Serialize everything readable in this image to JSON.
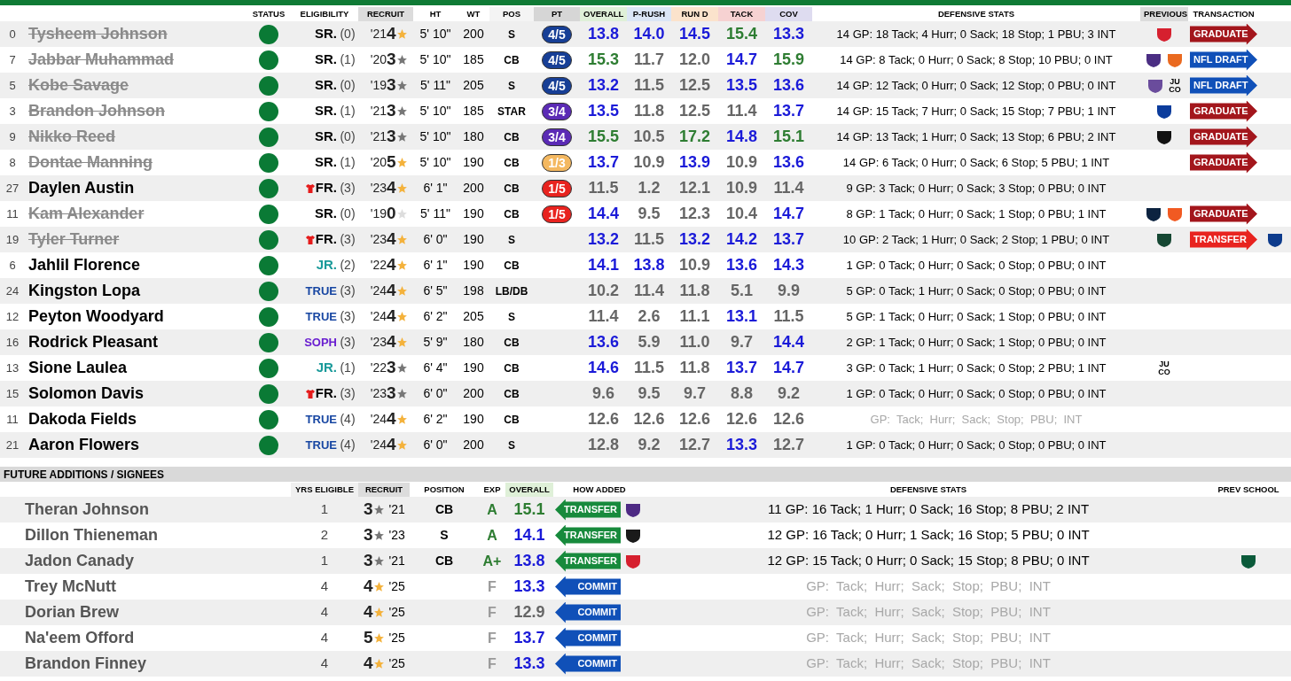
{
  "roster": {
    "columns": [
      {
        "label": "STATUS"
      },
      {
        "label": "ELIGIBILITY"
      },
      {
        "label": "RECRUIT",
        "color": "#dcdcdc"
      },
      {
        "label": "HT"
      },
      {
        "label": "WT"
      },
      {
        "label": "POS",
        "color": "#f4f4f4"
      },
      {
        "label": "PT",
        "color": "#d6d6d6"
      },
      {
        "label": "OVERALL",
        "color": "#dff0d8"
      },
      {
        "label": "P-RUSH",
        "color": "#dbe6f6"
      },
      {
        "label": "RUN D",
        "color": "#fbe3cc"
      },
      {
        "label": "TACK",
        "color": "#f6d2d2"
      },
      {
        "label": "COV",
        "color": "#dedcf0"
      },
      {
        "label": "DEFENSIVE STATS"
      },
      {
        "label": "PREVIOUS",
        "color": "#dcdcdc"
      },
      {
        "label": "TRANSACTION"
      }
    ],
    "rows": [
      {
        "number": "0",
        "name": "Tysheem Johnson",
        "departed": true,
        "class": {
          "text": "SR.",
          "color": "#000000"
        },
        "redshirt": false,
        "years": "(0)",
        "year": "'21",
        "rating": "4",
        "star": {
          "color": "#f4b23c"
        },
        "ht": "5' 10\"",
        "wt": "200",
        "pos": "S",
        "pt": {
          "text": "4/5",
          "color": "#173f96"
        },
        "grades": [
          {
            "value": "13.8",
            "color": "#1a1ad8"
          },
          {
            "value": "14.0",
            "color": "#1a1ad8"
          },
          {
            "value": "14.5",
            "color": "#1a1ad8"
          },
          {
            "value": "15.4",
            "color": "#2e7d32"
          },
          {
            "value": "13.3",
            "color": "#1a1ad8"
          }
        ],
        "stats": "14 GP: 18 Tack; 4 Hurr; 0 Sack; 18 Stop; 1 PBU; 3 INT",
        "faint": false,
        "previous": [
          {
            "kind": "logo",
            "color": "#d6202f"
          }
        ],
        "transaction": {
          "label": "GRADUATE",
          "kind": "graduate"
        }
      },
      {
        "number": "7",
        "name": "Jabbar Muhammad",
        "departed": true,
        "class": {
          "text": "SR.",
          "color": "#000000"
        },
        "redshirt": false,
        "years": "(1)",
        "year": "'20",
        "rating": "3",
        "star": {
          "color": "#777777"
        },
        "ht": "5' 10\"",
        "wt": "185",
        "pos": "CB",
        "pt": {
          "text": "4/5",
          "color": "#173f96"
        },
        "grades": [
          {
            "value": "15.3",
            "color": "#2e7d32"
          },
          {
            "value": "11.7",
            "color": "#666666"
          },
          {
            "value": "12.0",
            "color": "#666666"
          },
          {
            "value": "14.7",
            "color": "#1a1ad8"
          },
          {
            "value": "15.9",
            "color": "#2e7d32"
          }
        ],
        "stats": "14 GP: 8 Tack; 0 Hurr; 0 Sack; 8 Stop; 10 PBU; 0 INT",
        "faint": false,
        "previous": [
          {
            "kind": "logo",
            "color": "#4b2e83"
          },
          {
            "kind": "logo",
            "color": "#ea6a20"
          }
        ],
        "transaction": {
          "label": "NFL DRAFT",
          "kind": "draft"
        }
      },
      {
        "number": "5",
        "name": "Kobe Savage",
        "departed": true,
        "class": {
          "text": "SR.",
          "color": "#000000"
        },
        "redshirt": false,
        "years": "(0)",
        "year": "'19",
        "rating": "3",
        "star": {
          "color": "#777777"
        },
        "ht": "5' 11\"",
        "wt": "205",
        "pos": "S",
        "pt": {
          "text": "4/5",
          "color": "#173f96"
        },
        "grades": [
          {
            "value": "13.2",
            "color": "#1a1ad8"
          },
          {
            "value": "11.5",
            "color": "#666666"
          },
          {
            "value": "12.5",
            "color": "#666666"
          },
          {
            "value": "13.5",
            "color": "#1a1ad8"
          },
          {
            "value": "13.6",
            "color": "#1a1ad8"
          }
        ],
        "stats": "14 GP: 12 Tack; 0 Hurr; 0 Sack; 12 Stop; 0 PBU; 0 INT",
        "faint": false,
        "previous": [
          {
            "kind": "logo",
            "color": "#6a4c9c"
          },
          {
            "kind": "text",
            "text": "JU CO"
          }
        ],
        "transaction": {
          "label": "NFL DRAFT",
          "kind": "draft"
        }
      },
      {
        "number": "3",
        "name": "Brandon Johnson",
        "departed": true,
        "class": {
          "text": "SR.",
          "color": "#000000"
        },
        "redshirt": false,
        "years": "(1)",
        "year": "'21",
        "rating": "3",
        "star": {
          "color": "#777777"
        },
        "ht": "5' 10\"",
        "wt": "185",
        "pos": "STAR",
        "pt": {
          "text": "3/4",
          "color": "#5b2bb5"
        },
        "grades": [
          {
            "value": "13.5",
            "color": "#1a1ad8"
          },
          {
            "value": "11.8",
            "color": "#666666"
          },
          {
            "value": "12.5",
            "color": "#666666"
          },
          {
            "value": "11.4",
            "color": "#666666"
          },
          {
            "value": "13.7",
            "color": "#1a1ad8"
          }
        ],
        "stats": "14 GP: 15 Tack; 7 Hurr; 0 Sack; 15 Stop; 7 PBU; 1 INT",
        "faint": false,
        "previous": [
          {
            "kind": "logo",
            "color": "#0b3c9c"
          }
        ],
        "transaction": {
          "label": "GRADUATE",
          "kind": "graduate"
        }
      },
      {
        "number": "9",
        "name": "Nikko Reed",
        "departed": true,
        "class": {
          "text": "SR.",
          "color": "#000000"
        },
        "redshirt": false,
        "years": "(0)",
        "year": "'21",
        "rating": "3",
        "star": {
          "color": "#777777"
        },
        "ht": "5' 10\"",
        "wt": "180",
        "pos": "CB",
        "pt": {
          "text": "3/4",
          "color": "#5b2bb5"
        },
        "grades": [
          {
            "value": "15.5",
            "color": "#2e7d32"
          },
          {
            "value": "10.5",
            "color": "#666666"
          },
          {
            "value": "17.2",
            "color": "#2e7d32"
          },
          {
            "value": "14.8",
            "color": "#1a1ad8"
          },
          {
            "value": "15.1",
            "color": "#2e7d32"
          }
        ],
        "stats": "14 GP: 13 Tack; 1 Hurr; 0 Sack; 13 Stop; 6 PBU; 2 INT",
        "faint": false,
        "previous": [
          {
            "kind": "logo",
            "color": "#111111"
          }
        ],
        "transaction": {
          "label": "GRADUATE",
          "kind": "graduate"
        }
      },
      {
        "number": "8",
        "name": "Dontae Manning",
        "departed": true,
        "class": {
          "text": "SR.",
          "color": "#000000"
        },
        "redshirt": false,
        "years": "(1)",
        "year": "'20",
        "rating": "5",
        "star": {
          "color": "#f4b23c"
        },
        "ht": "5' 10\"",
        "wt": "190",
        "pos": "CB",
        "pt": {
          "text": "1/3",
          "color": "#f4b860"
        },
        "grades": [
          {
            "value": "13.7",
            "color": "#1a1ad8"
          },
          {
            "value": "10.9",
            "color": "#666666"
          },
          {
            "value": "13.9",
            "color": "#1a1ad8"
          },
          {
            "value": "10.9",
            "color": "#666666"
          },
          {
            "value": "13.6",
            "color": "#1a1ad8"
          }
        ],
        "stats": "14 GP: 6 Tack; 0 Hurr; 0 Sack; 6 Stop; 5 PBU; 1 INT",
        "faint": false,
        "transaction": {
          "label": "GRADUATE",
          "kind": "graduate"
        }
      },
      {
        "number": "27",
        "name": "Daylen Austin",
        "departed": false,
        "class": {
          "text": "FR.",
          "color": "#000000"
        },
        "redshirt": true,
        "years": "(3)",
        "year": "'23",
        "rating": "4",
        "star": {
          "color": "#f4b23c"
        },
        "ht": "6' 1\"",
        "wt": "200",
        "pos": "CB",
        "pt": {
          "text": "1/5",
          "color": "#e8231f"
        },
        "grades": [
          {
            "value": "11.5",
            "color": "#666666"
          },
          {
            "value": "1.2",
            "color": "#666666"
          },
          {
            "value": "12.1",
            "color": "#666666"
          },
          {
            "value": "10.9",
            "color": "#666666"
          },
          {
            "value": "11.4",
            "color": "#666666"
          }
        ],
        "stats": "9 GP: 3 Tack; 0 Hurr; 0 Sack; 3 Stop; 0 PBU; 0 INT",
        "faint": false
      },
      {
        "number": "11",
        "name": "Kam Alexander",
        "departed": true,
        "class": {
          "text": "SR.",
          "color": "#000000"
        },
        "redshirt": false,
        "years": "(0)",
        "year": "'19",
        "rating": "0",
        "star": {
          "color": "#dddddd"
        },
        "ht": "5' 11\"",
        "wt": "190",
        "pos": "CB",
        "pt": {
          "text": "1/5",
          "color": "#e8231f"
        },
        "grades": [
          {
            "value": "14.4",
            "color": "#1a1ad8"
          },
          {
            "value": "9.5",
            "color": "#666666"
          },
          {
            "value": "12.3",
            "color": "#666666"
          },
          {
            "value": "10.4",
            "color": "#666666"
          },
          {
            "value": "14.7",
            "color": "#1a1ad8"
          }
        ],
        "stats": "8 GP: 1 Tack; 0 Hurr; 0 Sack; 1 Stop; 0 PBU; 1 INT",
        "faint": false,
        "previous": [
          {
            "kind": "logo",
            "color": "#0c2340"
          },
          {
            "kind": "logo",
            "color": "#f15a22"
          }
        ],
        "transaction": {
          "label": "GRADUATE",
          "kind": "graduate"
        }
      },
      {
        "number": "19",
        "name": "Tyler Turner",
        "departed": true,
        "class": {
          "text": "FR.",
          "color": "#000000"
        },
        "redshirt": true,
        "years": "(3)",
        "year": "'23",
        "rating": "4",
        "star": {
          "color": "#f4b23c"
        },
        "ht": "6' 0\"",
        "wt": "190",
        "pos": "S",
        "grades": [
          {
            "value": "13.2",
            "color": "#1a1ad8"
          },
          {
            "value": "11.5",
            "color": "#666666"
          },
          {
            "value": "13.2",
            "color": "#1a1ad8"
          },
          {
            "value": "14.2",
            "color": "#1a1ad8"
          },
          {
            "value": "13.7",
            "color": "#1a1ad8"
          }
        ],
        "stats": "10 GP: 2 Tack; 1 Hurr; 0 Sack; 2 Stop; 1 PBU; 0 INT",
        "faint": false,
        "previous": [
          {
            "kind": "logo",
            "color": "#154733"
          }
        ],
        "transaction": {
          "label": "TRANSFER",
          "kind": "transfer"
        },
        "destination": {
          "kind": "logo",
          "color": "#0d3b8c"
        }
      },
      {
        "number": "6",
        "name": "Jahlil Florence",
        "departed": false,
        "class": {
          "text": "JR.",
          "color": "#1a9a9a"
        },
        "redshirt": false,
        "years": "(2)",
        "year": "'22",
        "rating": "4",
        "star": {
          "color": "#f4b23c"
        },
        "ht": "6' 1\"",
        "wt": "190",
        "pos": "CB",
        "grades": [
          {
            "value": "14.1",
            "color": "#1a1ad8"
          },
          {
            "value": "13.8",
            "color": "#1a1ad8"
          },
          {
            "value": "10.9",
            "color": "#666666"
          },
          {
            "value": "13.6",
            "color": "#1a1ad8"
          },
          {
            "value": "14.3",
            "color": "#1a1ad8"
          }
        ],
        "stats": "1 GP: 0 Tack; 0 Hurr; 0 Sack; 0 Stop; 0 PBU; 0 INT",
        "faint": false
      },
      {
        "number": "24",
        "name": "Kingston Lopa",
        "departed": false,
        "class": {
          "text": "TRUE",
          "color": "#1746a2"
        },
        "redshirt": false,
        "years": "(3)",
        "year": "'24",
        "rating": "4",
        "star": {
          "color": "#f4b23c"
        },
        "ht": "6' 5\"",
        "wt": "198",
        "pos": "LB/DB",
        "grades": [
          {
            "value": "10.2",
            "color": "#666666"
          },
          {
            "value": "11.4",
            "color": "#666666"
          },
          {
            "value": "11.8",
            "color": "#666666"
          },
          {
            "value": "5.1",
            "color": "#666666"
          },
          {
            "value": "9.9",
            "color": "#666666"
          }
        ],
        "stats": "5 GP: 0 Tack; 1 Hurr; 0 Sack; 0 Stop; 0 PBU; 0 INT",
        "faint": false
      },
      {
        "number": "12",
        "name": "Peyton Woodyard",
        "departed": false,
        "class": {
          "text": "TRUE",
          "color": "#1746a2"
        },
        "redshirt": false,
        "years": "(3)",
        "year": "'24",
        "rating": "4",
        "star": {
          "color": "#f4b23c"
        },
        "ht": "6' 2\"",
        "wt": "205",
        "pos": "S",
        "grades": [
          {
            "value": "11.4",
            "color": "#666666"
          },
          {
            "value": "2.6",
            "color": "#666666"
          },
          {
            "value": "11.1",
            "color": "#666666"
          },
          {
            "value": "13.1",
            "color": "#1a1ad8"
          },
          {
            "value": "11.5",
            "color": "#666666"
          }
        ],
        "stats": "5 GP: 1 Tack; 0 Hurr; 0 Sack; 1 Stop; 0 PBU; 0 INT",
        "faint": false
      },
      {
        "number": "16",
        "name": "Rodrick Pleasant",
        "departed": false,
        "class": {
          "text": "SOPH",
          "color": "#6a1fd0"
        },
        "redshirt": false,
        "years": "(3)",
        "year": "'23",
        "rating": "4",
        "star": {
          "color": "#f4b23c"
        },
        "ht": "5' 9\"",
        "wt": "180",
        "pos": "CB",
        "grades": [
          {
            "value": "13.6",
            "color": "#1a1ad8"
          },
          {
            "value": "5.9",
            "color": "#666666"
          },
          {
            "value": "11.0",
            "color": "#666666"
          },
          {
            "value": "9.7",
            "color": "#666666"
          },
          {
            "value": "14.4",
            "color": "#1a1ad8"
          }
        ],
        "stats": "2 GP: 1 Tack; 0 Hurr; 0 Sack; 1 Stop; 0 PBU; 0 INT",
        "faint": false
      },
      {
        "number": "13",
        "name": "Sione Laulea",
        "departed": false,
        "class": {
          "text": "JR.",
          "color": "#1a9a9a"
        },
        "redshirt": false,
        "years": "(1)",
        "year": "'22",
        "rating": "3",
        "star": {
          "color": "#777777"
        },
        "ht": "6' 4\"",
        "wt": "190",
        "pos": "CB",
        "grades": [
          {
            "value": "14.6",
            "color": "#1a1ad8"
          },
          {
            "value": "11.5",
            "color": "#666666"
          },
          {
            "value": "11.8",
            "color": "#666666"
          },
          {
            "value": "13.7",
            "color": "#1a1ad8"
          },
          {
            "value": "14.7",
            "color": "#1a1ad8"
          }
        ],
        "stats": "3 GP: 0 Tack; 1 Hurr; 0 Sack; 0 Stop; 2 PBU; 1 INT",
        "faint": false,
        "previous": [
          {
            "kind": "text",
            "text": "JU CO"
          }
        ]
      },
      {
        "number": "15",
        "name": "Solomon Davis",
        "departed": false,
        "class": {
          "text": "FR.",
          "color": "#000000"
        },
        "redshirt": true,
        "years": "(3)",
        "year": "'23",
        "rating": "3",
        "star": {
          "color": "#777777"
        },
        "ht": "6' 0\"",
        "wt": "200",
        "pos": "CB",
        "grades": [
          {
            "value": "9.6",
            "color": "#666666"
          },
          {
            "value": "9.5",
            "color": "#666666"
          },
          {
            "value": "9.7",
            "color": "#666666"
          },
          {
            "value": "8.8",
            "color": "#666666"
          },
          {
            "value": "9.2",
            "color": "#666666"
          }
        ],
        "stats": "1 GP: 0 Tack; 0 Hurr; 0 Sack; 0 Stop; 0 PBU; 0 INT",
        "faint": false
      },
      {
        "number": "11",
        "name": "Dakoda Fields",
        "departed": false,
        "class": {
          "text": "TRUE",
          "color": "#1746a2"
        },
        "redshirt": false,
        "years": "(4)",
        "year": "'24",
        "rating": "4",
        "star": {
          "color": "#f4b23c"
        },
        "ht": "6' 2\"",
        "wt": "190",
        "pos": "CB",
        "grades": [
          {
            "value": "12.6",
            "color": "#666666"
          },
          {
            "value": "12.6",
            "color": "#666666"
          },
          {
            "value": "12.6",
            "color": "#666666"
          },
          {
            "value": "12.6",
            "color": "#666666"
          },
          {
            "value": "12.6",
            "color": "#666666"
          }
        ],
        "stats": "GP:  Tack;  Hurr;  Sack;  Stop;  PBU;  INT",
        "faint": true
      },
      {
        "number": "21",
        "name": "Aaron Flowers",
        "departed": false,
        "class": {
          "text": "TRUE",
          "color": "#1746a2"
        },
        "redshirt": false,
        "years": "(4)",
        "year": "'24",
        "rating": "4",
        "star": {
          "color": "#f4b23c"
        },
        "ht": "6' 0\"",
        "wt": "200",
        "pos": "S",
        "grades": [
          {
            "value": "12.8",
            "color": "#666666"
          },
          {
            "value": "9.2",
            "color": "#666666"
          },
          {
            "value": "12.7",
            "color": "#666666"
          },
          {
            "value": "13.3",
            "color": "#1a1ad8"
          },
          {
            "value": "12.7",
            "color": "#666666"
          }
        ],
        "stats": "1 GP: 0 Tack; 0 Hurr; 0 Sack; 0 Stop; 0 PBU; 0 INT",
        "faint": false
      }
    ]
  },
  "additions": {
    "title": "FUTURE ADDITIONS / SIGNEES",
    "columns": [
      {
        "label": "YRS ELIGIBLE",
        "color": "#f0f0f0"
      },
      {
        "label": "RECRUIT",
        "color": "#dcdcdc"
      },
      {
        "label": "POSITION"
      },
      {
        "label": "EXP"
      },
      {
        "label": "OVERALL",
        "color": "#dff0d8"
      },
      {
        "label": "HOW ADDED"
      },
      {
        "label": "DEFENSIVE STATS"
      },
      {
        "label": "PREV SCHOOL"
      }
    ],
    "rows": [
      {
        "name": "Theran Johnson",
        "yrs": "1",
        "rating": "3",
        "star": {
          "color": "#777777"
        },
        "year": "'21",
        "pos": "CB",
        "exp": {
          "text": "A",
          "color": "#2e7d32"
        },
        "overall": {
          "value": "15.1",
          "color": "#2e7d32"
        },
        "how": {
          "label": "TRANSFER",
          "kind": "transfer"
        },
        "from": {
          "kind": "logo",
          "color": "#4e2a84"
        },
        "stats": "11 GP: 16 Tack; 1 Hurr; 0 Sack; 16 Stop; 8 PBU; 2 INT",
        "faint": false
      },
      {
        "name": "Dillon Thieneman",
        "yrs": "2",
        "rating": "3",
        "star": {
          "color": "#777777"
        },
        "year": "'23",
        "pos": "S",
        "exp": {
          "text": "A",
          "color": "#2e7d32"
        },
        "overall": {
          "value": "14.1",
          "color": "#1a1ad8"
        },
        "how": {
          "label": "TRANSFER",
          "kind": "transfer"
        },
        "from": {
          "kind": "logo",
          "color": "#1a1a1a"
        },
        "stats": "12 GP: 16 Tack; 0 Hurr; 1 Sack; 16 Stop; 5 PBU; 0 INT",
        "faint": false
      },
      {
        "name": "Jadon Canady",
        "yrs": "1",
        "rating": "3",
        "star": {
          "color": "#777777"
        },
        "year": "'21",
        "pos": "CB",
        "exp": {
          "text": "A+",
          "color": "#2e7d32"
        },
        "overall": {
          "value": "13.8",
          "color": "#1a1ad8"
        },
        "how": {
          "label": "TRANSFER",
          "kind": "transfer"
        },
        "from": {
          "kind": "logo",
          "color": "#d6202f"
        },
        "stats": "12 GP: 15 Tack; 0 Hurr; 0 Sack; 15 Stop; 8 PBU; 0 INT",
        "faint": false,
        "prev_school": {
          "kind": "logo",
          "color": "#0b5a3a"
        }
      },
      {
        "name": "Trey McNutt",
        "yrs": "4",
        "rating": "4",
        "star": {
          "color": "#f4b23c"
        },
        "year": "'25",
        "exp": {
          "text": "F",
          "color": "#999999"
        },
        "overall": {
          "value": "13.3",
          "color": "#1a1ad8"
        },
        "how": {
          "label": "COMMIT",
          "kind": "commit"
        },
        "stats": "GP:  Tack;  Hurr;  Sack;  Stop;  PBU;  INT",
        "faint": true
      },
      {
        "name": "Dorian Brew",
        "yrs": "4",
        "rating": "4",
        "star": {
          "color": "#f4b23c"
        },
        "year": "'25",
        "exp": {
          "text": "F",
          "color": "#999999"
        },
        "overall": {
          "value": "12.9",
          "color": "#666666"
        },
        "how": {
          "label": "COMMIT",
          "kind": "commit"
        },
        "stats": "GP:  Tack;  Hurr;  Sack;  Stop;  PBU;  INT",
        "faint": true
      },
      {
        "name": "Na'eem Offord",
        "yrs": "4",
        "rating": "5",
        "star": {
          "color": "#f4b23c"
        },
        "year": "'25",
        "exp": {
          "text": "F",
          "color": "#999999"
        },
        "overall": {
          "value": "13.7",
          "color": "#1a1ad8"
        },
        "how": {
          "label": "COMMIT",
          "kind": "commit"
        },
        "stats": "GP:  Tack;  Hurr;  Sack;  Stop;  PBU;  INT",
        "faint": true
      },
      {
        "name": "Brandon Finney",
        "yrs": "4",
        "rating": "4",
        "star": {
          "color": "#f4b23c"
        },
        "year": "'25",
        "exp": {
          "text": "F",
          "color": "#999999"
        },
        "overall": {
          "value": "13.3",
          "color": "#1a1ad8"
        },
        "how": {
          "label": "COMMIT",
          "kind": "commit"
        },
        "stats": "GP:  Tack;  Hurr;  Sack;  Stop;  PBU;  INT",
        "faint": true
      }
    ]
  }
}
